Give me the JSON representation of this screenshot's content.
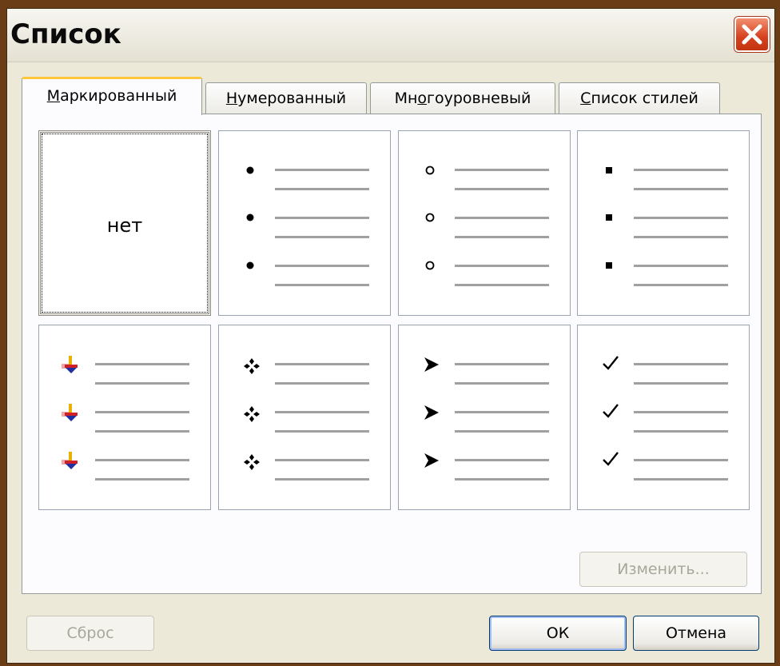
{
  "window": {
    "title": "Список"
  },
  "tabs": [
    {
      "pre": "",
      "accel": "М",
      "post": "аркированный",
      "active": true
    },
    {
      "pre": "",
      "accel": "Н",
      "post": "умерованный",
      "active": false
    },
    {
      "pre": "Мн",
      "accel": "о",
      "post": "гоуровневый",
      "active": false
    },
    {
      "pre": "",
      "accel": "С",
      "post": "писок стилей",
      "active": false
    }
  ],
  "bullet_styles": [
    {
      "id": "none",
      "label": "нет",
      "icon": "none"
    },
    {
      "id": "filled-circle",
      "icon": "filled-circle-bullet-icon"
    },
    {
      "id": "hollow-circle",
      "icon": "hollow-circle-bullet-icon"
    },
    {
      "id": "filled-square",
      "icon": "filled-square-bullet-icon"
    },
    {
      "id": "pushpin",
      "icon": "pushpin-bullet-icon"
    },
    {
      "id": "four-diamond",
      "icon": "four-diamond-bullet-icon"
    },
    {
      "id": "arrowhead",
      "icon": "arrowhead-bullet-icon"
    },
    {
      "id": "checkmark",
      "icon": "checkmark-bullet-icon"
    }
  ],
  "buttons": {
    "modify": "Изменить...",
    "reset": "Сброс",
    "ok": "ОК",
    "cancel": "Отмена"
  },
  "colors": {
    "title_text": "#0b0b0b",
    "close_button": "#d6401d",
    "active_tab_accent": "#ffc83c",
    "list_line": "#a0a0a0",
    "disabled_text": "#a9a79a"
  }
}
